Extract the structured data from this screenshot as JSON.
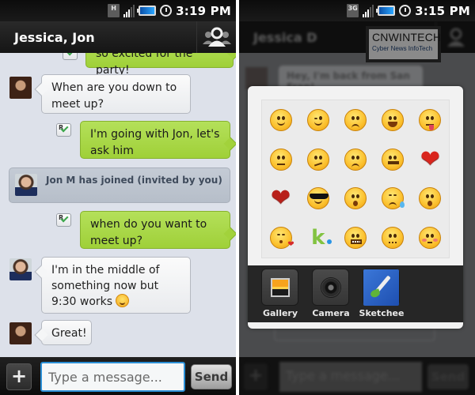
{
  "left_screen": {
    "status_bar": {
      "network_type": "H",
      "network_icon": "hspa-data-icon",
      "signal_icon": "signal-strength-icon",
      "battery_icon": "battery-icon",
      "alarm_icon": "alarm-clock-icon",
      "time": "3:19 PM"
    },
    "title_bar": {
      "title": "Jessica, Jon",
      "group_icon": "group-people-icon"
    },
    "messages": [
      {
        "direction": "out",
        "text": "so excited for the party!",
        "receipt": "delivered"
      },
      {
        "direction": "in",
        "sender": "Jessica",
        "text": "When are you down to meet up?"
      },
      {
        "direction": "out",
        "text": "I'm going with Jon, let's ask him",
        "receipt": "R"
      },
      {
        "type": "system",
        "sender": "Jon M",
        "text": "Jon M has joined (invited by you)"
      },
      {
        "direction": "out",
        "text": "when do you want to meet up?",
        "receipt": "R"
      },
      {
        "direction": "in",
        "sender": "Jon M",
        "text": "I'm in the middle of something now but 9:30 works",
        "emoji": "smile"
      },
      {
        "direction": "in",
        "sender": "Jessica",
        "text": "Great!"
      }
    ],
    "receipt_label": "R",
    "input_bar": {
      "plus_label": "+",
      "placeholder": "Type a message...",
      "value": "",
      "send_label": "Send"
    }
  },
  "right_screen": {
    "status_bar": {
      "network_type": "3G",
      "network_icon": "3g-data-icon",
      "signal_icon": "signal-strength-icon",
      "battery_icon": "battery-icon",
      "alarm_icon": "alarm-clock-icon",
      "time": "3:15 PM"
    },
    "title_bar": {
      "title": "Jessica D"
    },
    "watermark": {
      "title": "CNWINTECH",
      "subtitle": "Cyber News InfoTech"
    },
    "background_message": "Hey, I'm back from San Fran!",
    "emoji_picker": {
      "emojis": [
        "smile",
        "wink",
        "worried",
        "grin",
        "tongue-out",
        "neutral",
        "confused",
        "angry",
        "zipped-mouth",
        "heart",
        "broken-heart",
        "sunglasses",
        "embarrassed",
        "sweat",
        "surprised",
        "kiss",
        "kik-logo",
        "grimace",
        "wavy-mouth",
        "blush-sad"
      ]
    },
    "attachments": [
      {
        "label": "Gallery",
        "icon": "gallery-icon"
      },
      {
        "label": "Camera",
        "icon": "camera-icon"
      },
      {
        "label": "Sketchee",
        "icon": "sketchee-icon"
      }
    ],
    "input_bar": {
      "plus_label": "+",
      "placeholder": "Type a message...",
      "send_label": "Send"
    }
  }
}
